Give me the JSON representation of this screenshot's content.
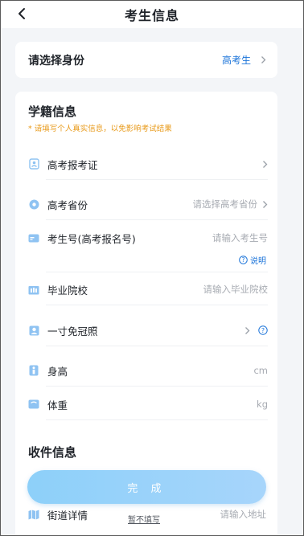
{
  "navbar": {
    "title": "考生信息"
  },
  "identity": {
    "label": "请选择身份",
    "value": "高考生"
  },
  "school_section": {
    "title": "学籍信息",
    "notice": "* 请填写个人真实信息，以免影响考试结果",
    "rows": [
      {
        "label": "高考报考证",
        "value": ""
      },
      {
        "label": "高考省份",
        "value": "请选择高考省份"
      },
      {
        "label": "考生号(高考报名号)",
        "value": "请输入考生号"
      },
      {
        "label": "毕业院校",
        "value": "请输入毕业院校"
      },
      {
        "label": "一寸免冠照",
        "value": ""
      },
      {
        "label": "身高",
        "value": "cm"
      },
      {
        "label": "体重",
        "value": "kg"
      }
    ],
    "explain_label": "说明"
  },
  "receive_section": {
    "title": "收件信息"
  },
  "street_row": {
    "label": "街道详情",
    "value": "请输入地址"
  },
  "done_button": {
    "label": "完 成"
  },
  "skip_link": {
    "label": "暂不填写"
  },
  "colors": {
    "accent": "#1a73d9",
    "notice": "#e89a1a",
    "icon": "#8fc3f2"
  }
}
